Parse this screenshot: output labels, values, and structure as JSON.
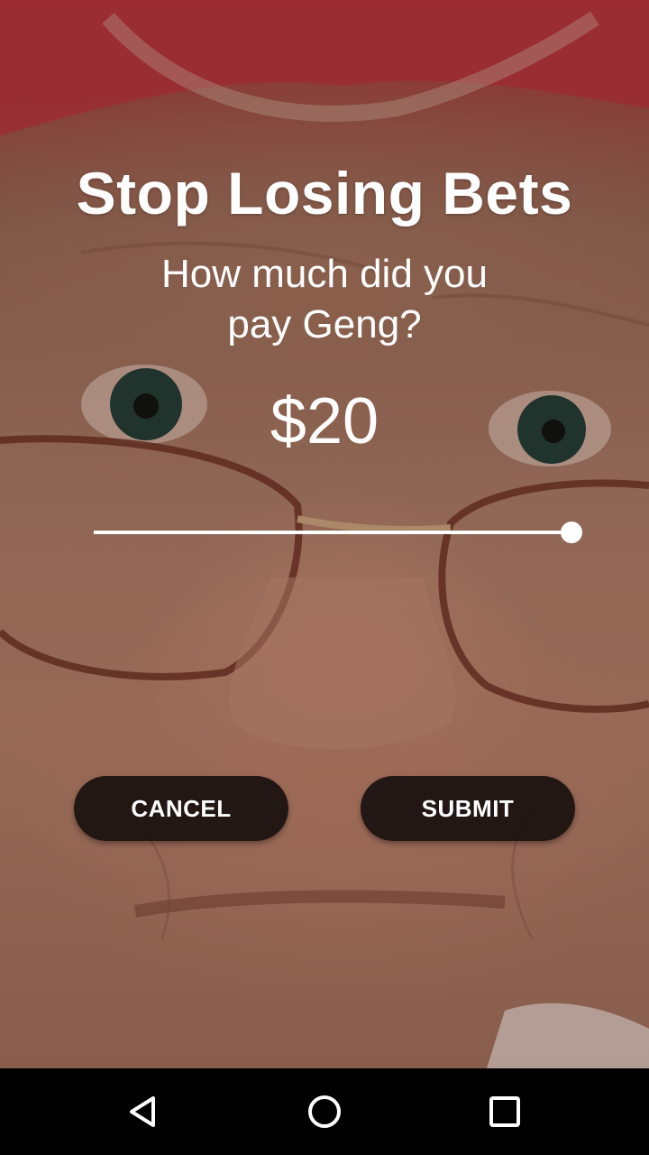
{
  "dialog": {
    "title": "Stop Losing Bets",
    "question_line1": "How much did you",
    "question_line2": "pay Geng?",
    "amount_display": "$20",
    "slider_value_fraction": 1.0
  },
  "buttons": {
    "cancel_label": "CANCEL",
    "submit_label": "SUBMIT"
  },
  "navbar": {
    "back_icon": "back-triangle-icon",
    "home_icon": "home-circle-icon",
    "recents_icon": "recents-square-icon"
  },
  "colors": {
    "text": "#ffffff",
    "button_bg": "#18100e",
    "navbar_bg": "#000000"
  }
}
